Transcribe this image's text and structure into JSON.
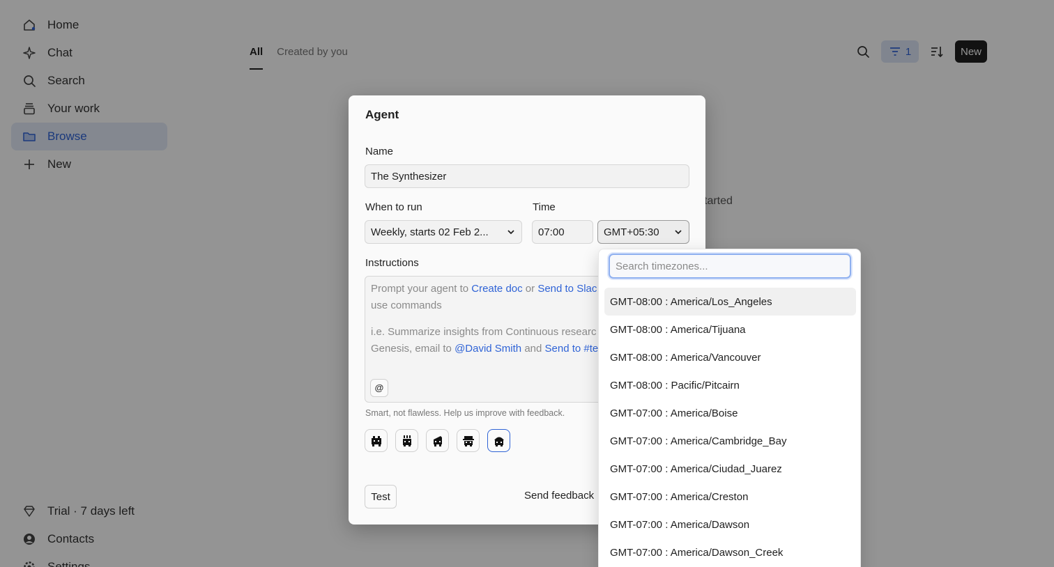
{
  "sidebar": {
    "items": [
      {
        "label": "Home",
        "icon": "home-icon"
      },
      {
        "label": "Chat",
        "icon": "sparkle-icon"
      },
      {
        "label": "Search",
        "icon": "search-icon"
      },
      {
        "label": "Your work",
        "icon": "stack-icon"
      },
      {
        "label": "Browse",
        "icon": "folder-icon",
        "active": true
      },
      {
        "label": "New",
        "icon": "plus-icon"
      }
    ],
    "bottom_items": [
      {
        "label": "Trial · 7 days left",
        "icon": "diamond-icon"
      },
      {
        "label": "Contacts",
        "icon": "user-circle-icon"
      },
      {
        "label": "Settings",
        "icon": "gear-icon"
      }
    ]
  },
  "main": {
    "tabs": [
      {
        "label": "All",
        "active": true
      },
      {
        "label": "Created by you"
      }
    ],
    "filter_count": "1",
    "new_label": "New",
    "bg_hint": "tarted"
  },
  "modal": {
    "title": "Agent",
    "name_label": "Name",
    "name_value": "The Synthesizer",
    "when_label": "When to run",
    "when_value": "Weekly, starts 02 Feb 2...",
    "time_label": "Time",
    "time_value": "07:00",
    "timezone_value": "GMT+05:30",
    "instructions_label": "Instructions",
    "instructions": {
      "prompt_prefix": "Prompt your agent to",
      "cmd_create_doc": "Create doc",
      "or_word": "or",
      "cmd_send_slack": "Send to Slac",
      "use_commands": "use commands",
      "example_prefix": "i.e. Summarize insights from Continuous researc",
      "example_line2_prefix": "Genesis, email to",
      "mention": "@David Smith",
      "and_word": "and",
      "cmd_send_team": "Send to #te",
      "at_symbol": "@"
    },
    "hint": "Smart, not flawless. Help us improve with feedback.",
    "test_label": "Test",
    "feedback_label": "Send feedback"
  },
  "timezone_dropdown": {
    "placeholder": "Search timezones...",
    "options": [
      "GMT-08:00 : America/Los_Angeles",
      "GMT-08:00 : America/Tijuana",
      "GMT-08:00 : America/Vancouver",
      "GMT-08:00 : Pacific/Pitcairn",
      "GMT-07:00 : America/Boise",
      "GMT-07:00 : America/Cambridge_Bay",
      "GMT-07:00 : America/Ciudad_Juarez",
      "GMT-07:00 : America/Creston",
      "GMT-07:00 : America/Dawson",
      "GMT-07:00 : America/Dawson_Creek"
    ],
    "highlighted_index": 0
  },
  "colors": {
    "accent": "#2f63d6",
    "overlay": "rgba(0,0,0,0.42)"
  }
}
